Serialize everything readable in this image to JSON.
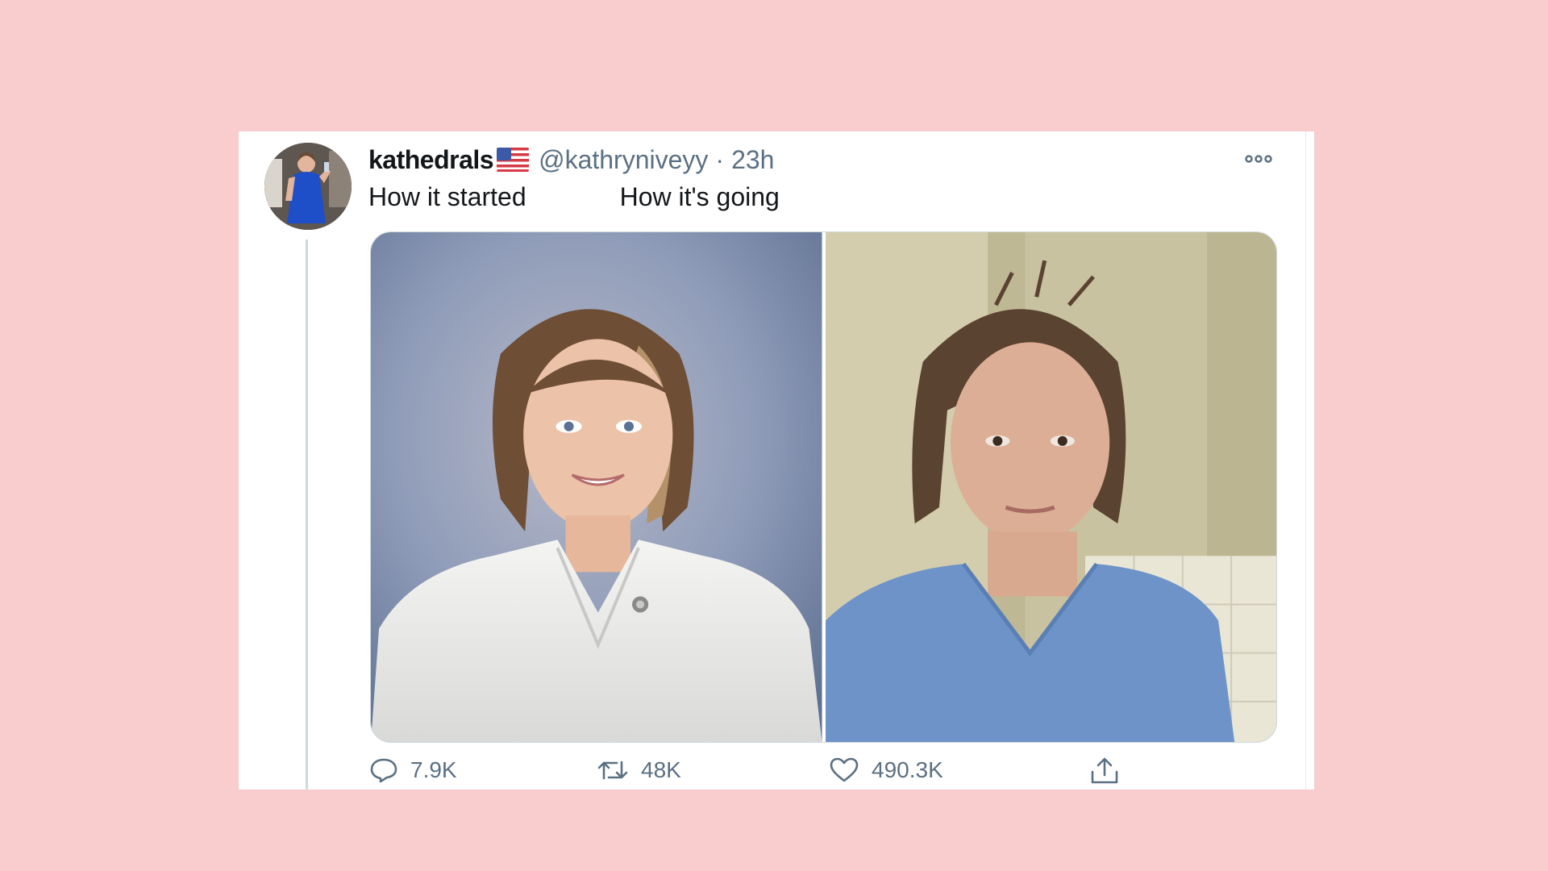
{
  "tweet": {
    "display_name": "kathedrals",
    "flag": "us-flag-emoji",
    "handle": "@kathryniveyy",
    "separator": "·",
    "time": "23h",
    "text_left": "How it started",
    "text_right": "How it's going"
  },
  "media": {
    "left_image": "portrait-white-uniform",
    "right_image": "selfie-blue-scrubs"
  },
  "actions": {
    "reply_count": "7.9K",
    "retweet_count": "48K",
    "like_count": "490.3K"
  },
  "icons": [
    "more-icon",
    "reply-icon",
    "retweet-icon",
    "like-icon",
    "share-icon"
  ],
  "colors": {
    "background": "#f9cccd",
    "card": "#ffffff",
    "primary_text": "#14171a",
    "secondary_text": "#5b7083"
  }
}
